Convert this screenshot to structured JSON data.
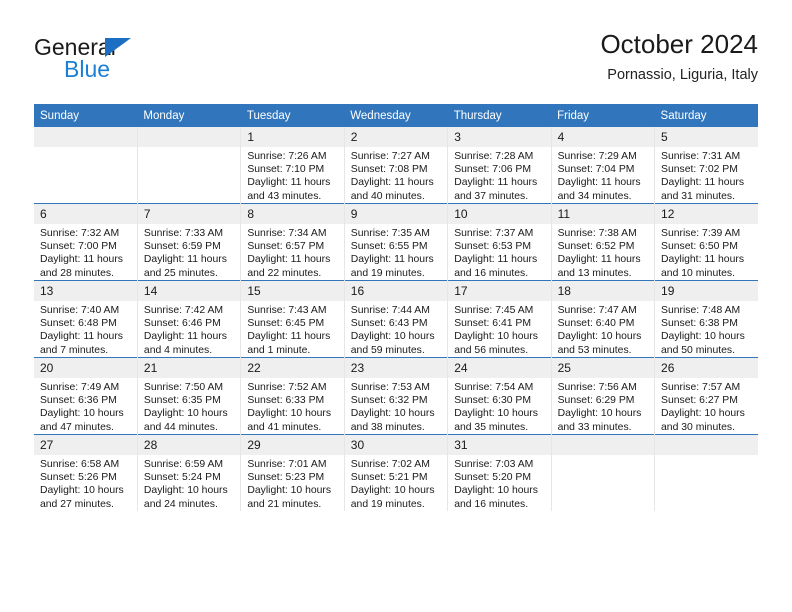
{
  "brand": {
    "name_top": "General",
    "name_bottom": "Blue",
    "triangle_color": "#1b6ec2",
    "blue_color": "#1b7fd4"
  },
  "header": {
    "title": "October 2024",
    "subtitle": "Pornassio, Liguria, Italy"
  },
  "theme": {
    "header_bg": "#3176bc",
    "daynum_bg": "#efefef",
    "row_divider": "#3176bc",
    "col_divider": "#e6e6e6"
  },
  "weekdays": [
    "Sunday",
    "Monday",
    "Tuesday",
    "Wednesday",
    "Thursday",
    "Friday",
    "Saturday"
  ],
  "weeks": [
    [
      {
        "day": "",
        "sunrise": "",
        "sunset": "",
        "daylight_1": "",
        "daylight_2": ""
      },
      {
        "day": "",
        "sunrise": "",
        "sunset": "",
        "daylight_1": "",
        "daylight_2": ""
      },
      {
        "day": "1",
        "sunrise": "Sunrise: 7:26 AM",
        "sunset": "Sunset: 7:10 PM",
        "daylight_1": "Daylight: 11 hours",
        "daylight_2": "and 43 minutes."
      },
      {
        "day": "2",
        "sunrise": "Sunrise: 7:27 AM",
        "sunset": "Sunset: 7:08 PM",
        "daylight_1": "Daylight: 11 hours",
        "daylight_2": "and 40 minutes."
      },
      {
        "day": "3",
        "sunrise": "Sunrise: 7:28 AM",
        "sunset": "Sunset: 7:06 PM",
        "daylight_1": "Daylight: 11 hours",
        "daylight_2": "and 37 minutes."
      },
      {
        "day": "4",
        "sunrise": "Sunrise: 7:29 AM",
        "sunset": "Sunset: 7:04 PM",
        "daylight_1": "Daylight: 11 hours",
        "daylight_2": "and 34 minutes."
      },
      {
        "day": "5",
        "sunrise": "Sunrise: 7:31 AM",
        "sunset": "Sunset: 7:02 PM",
        "daylight_1": "Daylight: 11 hours",
        "daylight_2": "and 31 minutes."
      }
    ],
    [
      {
        "day": "6",
        "sunrise": "Sunrise: 7:32 AM",
        "sunset": "Sunset: 7:00 PM",
        "daylight_1": "Daylight: 11 hours",
        "daylight_2": "and 28 minutes."
      },
      {
        "day": "7",
        "sunrise": "Sunrise: 7:33 AM",
        "sunset": "Sunset: 6:59 PM",
        "daylight_1": "Daylight: 11 hours",
        "daylight_2": "and 25 minutes."
      },
      {
        "day": "8",
        "sunrise": "Sunrise: 7:34 AM",
        "sunset": "Sunset: 6:57 PM",
        "daylight_1": "Daylight: 11 hours",
        "daylight_2": "and 22 minutes."
      },
      {
        "day": "9",
        "sunrise": "Sunrise: 7:35 AM",
        "sunset": "Sunset: 6:55 PM",
        "daylight_1": "Daylight: 11 hours",
        "daylight_2": "and 19 minutes."
      },
      {
        "day": "10",
        "sunrise": "Sunrise: 7:37 AM",
        "sunset": "Sunset: 6:53 PM",
        "daylight_1": "Daylight: 11 hours",
        "daylight_2": "and 16 minutes."
      },
      {
        "day": "11",
        "sunrise": "Sunrise: 7:38 AM",
        "sunset": "Sunset: 6:52 PM",
        "daylight_1": "Daylight: 11 hours",
        "daylight_2": "and 13 minutes."
      },
      {
        "day": "12",
        "sunrise": "Sunrise: 7:39 AM",
        "sunset": "Sunset: 6:50 PM",
        "daylight_1": "Daylight: 11 hours",
        "daylight_2": "and 10 minutes."
      }
    ],
    [
      {
        "day": "13",
        "sunrise": "Sunrise: 7:40 AM",
        "sunset": "Sunset: 6:48 PM",
        "daylight_1": "Daylight: 11 hours",
        "daylight_2": "and 7 minutes."
      },
      {
        "day": "14",
        "sunrise": "Sunrise: 7:42 AM",
        "sunset": "Sunset: 6:46 PM",
        "daylight_1": "Daylight: 11 hours",
        "daylight_2": "and 4 minutes."
      },
      {
        "day": "15",
        "sunrise": "Sunrise: 7:43 AM",
        "sunset": "Sunset: 6:45 PM",
        "daylight_1": "Daylight: 11 hours",
        "daylight_2": "and 1 minute."
      },
      {
        "day": "16",
        "sunrise": "Sunrise: 7:44 AM",
        "sunset": "Sunset: 6:43 PM",
        "daylight_1": "Daylight: 10 hours",
        "daylight_2": "and 59 minutes."
      },
      {
        "day": "17",
        "sunrise": "Sunrise: 7:45 AM",
        "sunset": "Sunset: 6:41 PM",
        "daylight_1": "Daylight: 10 hours",
        "daylight_2": "and 56 minutes."
      },
      {
        "day": "18",
        "sunrise": "Sunrise: 7:47 AM",
        "sunset": "Sunset: 6:40 PM",
        "daylight_1": "Daylight: 10 hours",
        "daylight_2": "and 53 minutes."
      },
      {
        "day": "19",
        "sunrise": "Sunrise: 7:48 AM",
        "sunset": "Sunset: 6:38 PM",
        "daylight_1": "Daylight: 10 hours",
        "daylight_2": "and 50 minutes."
      }
    ],
    [
      {
        "day": "20",
        "sunrise": "Sunrise: 7:49 AM",
        "sunset": "Sunset: 6:36 PM",
        "daylight_1": "Daylight: 10 hours",
        "daylight_2": "and 47 minutes."
      },
      {
        "day": "21",
        "sunrise": "Sunrise: 7:50 AM",
        "sunset": "Sunset: 6:35 PM",
        "daylight_1": "Daylight: 10 hours",
        "daylight_2": "and 44 minutes."
      },
      {
        "day": "22",
        "sunrise": "Sunrise: 7:52 AM",
        "sunset": "Sunset: 6:33 PM",
        "daylight_1": "Daylight: 10 hours",
        "daylight_2": "and 41 minutes."
      },
      {
        "day": "23",
        "sunrise": "Sunrise: 7:53 AM",
        "sunset": "Sunset: 6:32 PM",
        "daylight_1": "Daylight: 10 hours",
        "daylight_2": "and 38 minutes."
      },
      {
        "day": "24",
        "sunrise": "Sunrise: 7:54 AM",
        "sunset": "Sunset: 6:30 PM",
        "daylight_1": "Daylight: 10 hours",
        "daylight_2": "and 35 minutes."
      },
      {
        "day": "25",
        "sunrise": "Sunrise: 7:56 AM",
        "sunset": "Sunset: 6:29 PM",
        "daylight_1": "Daylight: 10 hours",
        "daylight_2": "and 33 minutes."
      },
      {
        "day": "26",
        "sunrise": "Sunrise: 7:57 AM",
        "sunset": "Sunset: 6:27 PM",
        "daylight_1": "Daylight: 10 hours",
        "daylight_2": "and 30 minutes."
      }
    ],
    [
      {
        "day": "27",
        "sunrise": "Sunrise: 6:58 AM",
        "sunset": "Sunset: 5:26 PM",
        "daylight_1": "Daylight: 10 hours",
        "daylight_2": "and 27 minutes."
      },
      {
        "day": "28",
        "sunrise": "Sunrise: 6:59 AM",
        "sunset": "Sunset: 5:24 PM",
        "daylight_1": "Daylight: 10 hours",
        "daylight_2": "and 24 minutes."
      },
      {
        "day": "29",
        "sunrise": "Sunrise: 7:01 AM",
        "sunset": "Sunset: 5:23 PM",
        "daylight_1": "Daylight: 10 hours",
        "daylight_2": "and 21 minutes."
      },
      {
        "day": "30",
        "sunrise": "Sunrise: 7:02 AM",
        "sunset": "Sunset: 5:21 PM",
        "daylight_1": "Daylight: 10 hours",
        "daylight_2": "and 19 minutes."
      },
      {
        "day": "31",
        "sunrise": "Sunrise: 7:03 AM",
        "sunset": "Sunset: 5:20 PM",
        "daylight_1": "Daylight: 10 hours",
        "daylight_2": "and 16 minutes."
      },
      {
        "day": "",
        "sunrise": "",
        "sunset": "",
        "daylight_1": "",
        "daylight_2": ""
      },
      {
        "day": "",
        "sunrise": "",
        "sunset": "",
        "daylight_1": "",
        "daylight_2": ""
      }
    ]
  ]
}
